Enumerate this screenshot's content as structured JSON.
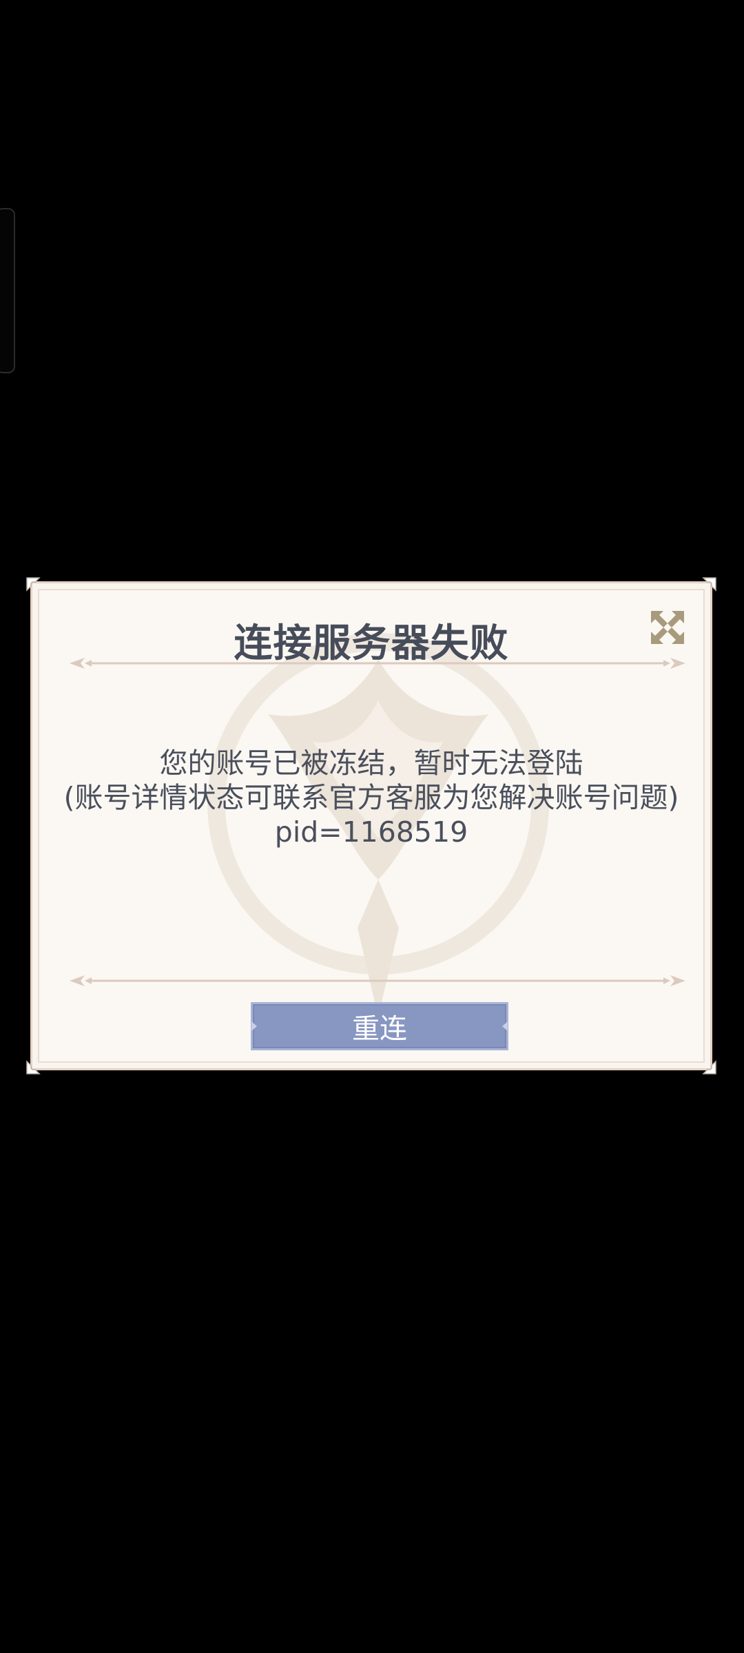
{
  "dialog": {
    "title": "连接服务器失败",
    "message_line1": "您的账号已被冻结，暂时无法登陆",
    "message_line2": "(账号详情状态可联系官方客服为您解决账号问题)",
    "message_line3": "pid=1168519",
    "retry_label": "重连",
    "close_icon": "close-x-icon"
  },
  "colors": {
    "background": "#000000",
    "panel": "#fbf8f3",
    "title_text": "#474c5a",
    "button": "#8896c2",
    "close_icon": "#a89a7c"
  }
}
